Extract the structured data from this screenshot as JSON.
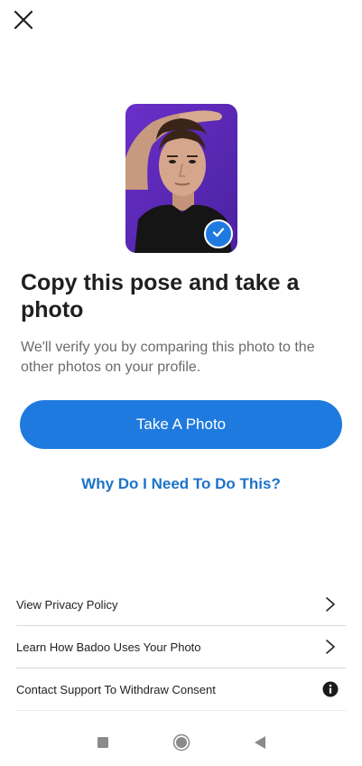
{
  "header": {
    "close_icon": "close-icon"
  },
  "hero": {
    "badge_icon": "checkmark-icon",
    "badge_color": "#1f7ae0",
    "photo_background": "#5a2bb8"
  },
  "content": {
    "title": "Copy this pose and take a photo",
    "subtitle": "We'll verify you by comparing this photo to the other photos on your profile."
  },
  "actions": {
    "primary_label": "Take A Photo",
    "primary_color": "#1f7ae0",
    "help_link_label": "Why Do I Need To Do This?"
  },
  "menu": {
    "items": [
      {
        "label": "View Privacy Policy",
        "icon": "chevron-right-icon"
      },
      {
        "label": "Learn How Badoo Uses Your Photo",
        "icon": "chevron-right-icon"
      },
      {
        "label": "Contact Support To Withdraw Consent",
        "icon": "info-icon"
      }
    ]
  },
  "navbar": {
    "items": [
      "recents-square-icon",
      "home-circle-icon",
      "back-triangle-icon"
    ]
  }
}
